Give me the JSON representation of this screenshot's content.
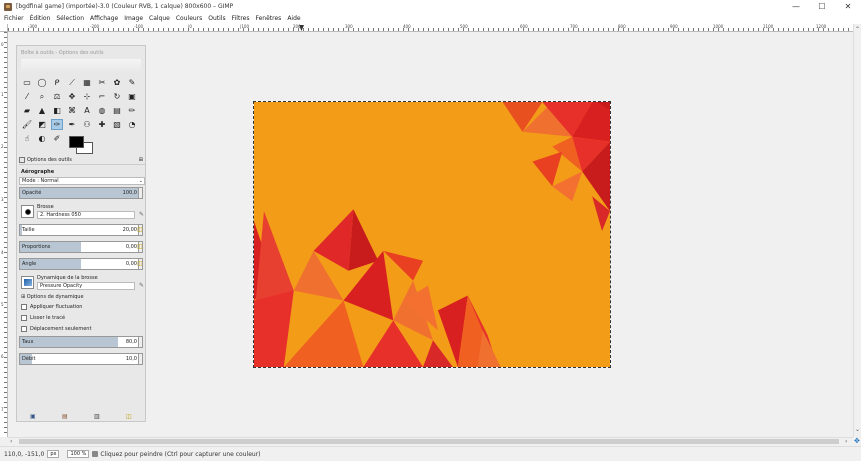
{
  "window": {
    "title": "[bgdfinal game] (importée)-3.0 (Couleur RVB, 1 calque) 800x600 – GIMP",
    "minimize": "—",
    "maximize": "☐",
    "close": "✕"
  },
  "menu": [
    "Fichier",
    "Édition",
    "Sélection",
    "Affichage",
    "Image",
    "Calque",
    "Couleurs",
    "Outils",
    "Filtres",
    "Fenêtres",
    "Aide"
  ],
  "rulers": {
    "top": [
      "-300",
      "-200",
      "-100",
      "|0",
      "|100",
      "200",
      "300",
      "400",
      "500",
      "600",
      "700",
      "800",
      "900",
      "1000",
      "1100",
      "1200"
    ],
    "left": [
      "0",
      "1",
      "2",
      "3",
      "4",
      "5",
      "6",
      "7"
    ]
  },
  "toolbox": {
    "title": "Boîte à outils - Options des outils",
    "tools": [
      {
        "icon": "rect-select-icon",
        "glyph": "▭"
      },
      {
        "icon": "ellipse-select-icon",
        "glyph": "◯"
      },
      {
        "icon": "free-select-icon",
        "glyph": "ᑭ"
      },
      {
        "icon": "fuzzy-select-icon",
        "glyph": "⟋"
      },
      {
        "icon": "color-select-icon",
        "glyph": "▦"
      },
      {
        "icon": "scissors-icon",
        "glyph": "✂"
      },
      {
        "icon": "foreground-select-icon",
        "glyph": "✿"
      },
      {
        "icon": "paths-icon",
        "glyph": "✎"
      },
      {
        "icon": "color-picker-icon",
        "glyph": "⁄"
      },
      {
        "icon": "zoom-icon",
        "glyph": "⌕"
      },
      {
        "icon": "measure-icon",
        "glyph": "⚖"
      },
      {
        "icon": "move-icon",
        "glyph": "✥"
      },
      {
        "icon": "align-icon",
        "glyph": "⊹"
      },
      {
        "icon": "crop-icon",
        "glyph": "⌐"
      },
      {
        "icon": "rotate-icon",
        "glyph": "↻"
      },
      {
        "icon": "scale-icon",
        "glyph": "▣"
      },
      {
        "icon": "shear-icon",
        "glyph": "▰"
      },
      {
        "icon": "perspective-icon",
        "glyph": "▲"
      },
      {
        "icon": "flip-icon",
        "glyph": "◧"
      },
      {
        "icon": "cage-icon",
        "glyph": "⌘"
      },
      {
        "icon": "text-icon",
        "glyph": "A"
      },
      {
        "icon": "bucket-fill-icon",
        "glyph": "◍"
      },
      {
        "icon": "blend-icon",
        "glyph": "▤"
      },
      {
        "icon": "pencil-icon",
        "glyph": "✏"
      },
      {
        "icon": "paintbrush-icon",
        "glyph": "🖌"
      },
      {
        "icon": "eraser-icon",
        "glyph": "◩"
      },
      {
        "icon": "airbrush-icon",
        "glyph": "✑"
      },
      {
        "icon": "ink-icon",
        "glyph": "✒"
      },
      {
        "icon": "clone-icon",
        "glyph": "⚇"
      },
      {
        "icon": "heal-icon",
        "glyph": "✚"
      },
      {
        "icon": "perspective-clone-icon",
        "glyph": "▧"
      },
      {
        "icon": "blur-icon",
        "glyph": "◔"
      },
      {
        "icon": "smudge-icon",
        "glyph": "☝"
      },
      {
        "icon": "dodge-burn-icon",
        "glyph": "◐"
      },
      {
        "icon": "dodge-icon",
        "glyph": "✐"
      }
    ],
    "active_tool": 26,
    "fg_color": "#000000",
    "bg_color": "#ffffff"
  },
  "options": {
    "tab_label": "Options des outils",
    "tool_name": "Aérographe",
    "mode_label": "Mode :",
    "mode_value": "Normal",
    "opacity_label": "Opacité",
    "opacity_value": "100,0",
    "opacity_fraction": 1.0,
    "brush_label": "Brosse",
    "brush_value": "2. Hardness 050",
    "size_label": "Taille",
    "size_value": "20,00",
    "size_fraction": 0.02,
    "aspect_label": "Proportions",
    "aspect_value": "0,00",
    "aspect_fraction": 0.5,
    "angle_label": "Angle",
    "angle_value": "0,00",
    "angle_fraction": 0.5,
    "dynamics_label": "Dynamique de la brosse",
    "dynamics_value": "Pressure Opacity",
    "dynamics_options": "Options de dynamique",
    "apply_jitter": "Appliquer fluctuation",
    "smooth_stroke": "Lisser le tracé",
    "incremental": "Déplacement seulement",
    "rate_label": "Taux",
    "rate_value": "80,0",
    "rate_fraction": 0.8,
    "flow_label": "Débit",
    "flow_value": "10,0",
    "flow_fraction": 0.1
  },
  "status": {
    "coords": "110,0, -151,0",
    "unit": "px",
    "zoom": "100 %",
    "hint": "Cliquez pour peindre (Ctrl pour capturer une couleur)"
  },
  "colors": {
    "image_bg": "#f39c18",
    "red": "#d42020",
    "orange": "#f06020"
  }
}
